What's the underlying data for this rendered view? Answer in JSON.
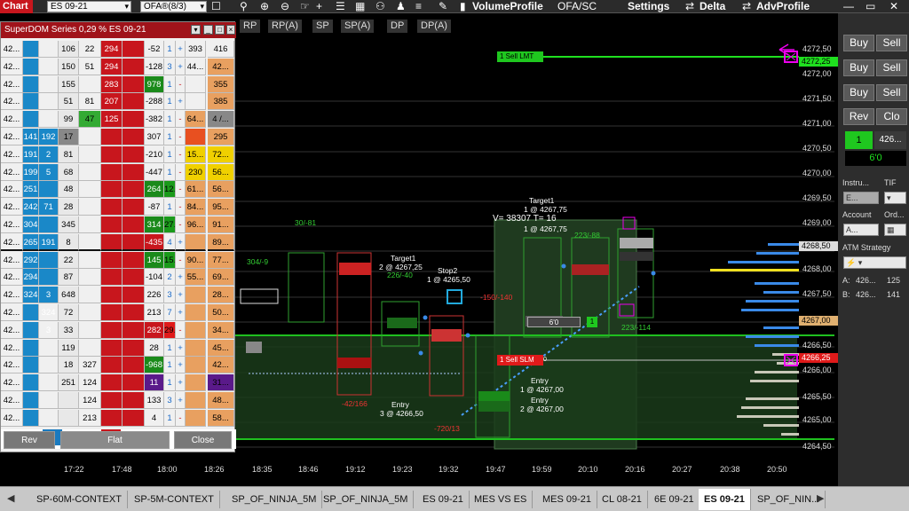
{
  "topbar": {
    "chart_label": "Chart",
    "instrument": "ES 09-21",
    "template": "OFA®(8/3)",
    "items": [
      "VolumeProfile",
      "OFA/SC",
      "Settings",
      "Delta",
      "AdvProfile"
    ]
  },
  "toolbar2": [
    "RP",
    "RP(A)",
    "SP",
    "SP(A)",
    "DP",
    "DP(A)"
  ],
  "price_axis": [
    "4272,50",
    "4272,25",
    "4272,00",
    "4271,50",
    "4271,00",
    "4270,50",
    "4270,00",
    "4269,50",
    "4269,00",
    "4268,50",
    "4268,00",
    "4267,50",
    "4267,00",
    "4266,50",
    "4266,25",
    "4266,00",
    "4265,50",
    "4265,00",
    "4264,50"
  ],
  "time_axis": [
    "17:22",
    "17:48",
    "18:00",
    "18:26",
    "18:35",
    "18:46",
    "19:12",
    "19:23",
    "19:32",
    "19:47",
    "19:59",
    "20:10",
    "20:16",
    "20:27",
    "20:38",
    "20:50"
  ],
  "dom": {
    "title": "SuperDOM Series 0,29 % ES 09-21",
    "header_price": "---",
    "rows": [
      [
        "42...",
        "",
        "",
        "106",
        "22",
        "294",
        "",
        "-52",
        "1",
        "+",
        "393",
        "416"
      ],
      [
        "42...",
        "",
        "",
        "150",
        "51",
        "294",
        "",
        "-128",
        "3",
        "+",
        "44...",
        "42..."
      ],
      [
        "42...",
        "",
        "",
        "155",
        "",
        "283",
        "",
        "978",
        "1",
        "-",
        "",
        "355"
      ],
      [
        "42...",
        "",
        "",
        "51",
        "81",
        "207",
        "",
        "-288",
        "1",
        "+",
        "",
        "385"
      ],
      [
        "42...",
        "",
        "",
        "99",
        "47",
        "125",
        "",
        "-382",
        "1",
        "-",
        "64...",
        "4 /..."
      ],
      [
        "42...",
        "141",
        "192",
        "17",
        "",
        "",
        "",
        "307",
        "1",
        "-",
        "",
        "295"
      ],
      [
        "42...",
        "191",
        "2",
        "81",
        "",
        "",
        "",
        "-210",
        "1",
        "-",
        "15...",
        "72..."
      ],
      [
        "42...",
        "199",
        "5",
        "68",
        "",
        "",
        "",
        "-447",
        "1",
        "-",
        "230",
        "56..."
      ],
      [
        "42...",
        "251",
        "",
        "48",
        "",
        "",
        "",
        "264",
        "12...",
        "-",
        "61...",
        "56..."
      ],
      [
        "42...",
        "242",
        "71",
        "28",
        "",
        "",
        "",
        "-87",
        "1",
        "-",
        "84...",
        "95..."
      ],
      [
        "42...",
        "304",
        "",
        "345",
        "",
        "",
        "",
        "314",
        "27...",
        "-",
        "96...",
        "91..."
      ],
      [
        "42...",
        "265",
        "191",
        "8",
        "",
        "",
        "",
        "-435",
        "4",
        "+",
        "",
        "89..."
      ],
      [
        "42...",
        "292",
        "",
        "22",
        "",
        "",
        "",
        "145",
        "15...",
        "-",
        "90...",
        "77..."
      ],
      [
        "42...",
        "294",
        "",
        "87",
        "",
        "",
        "",
        "-104",
        "2",
        "+",
        "55...",
        "69..."
      ],
      [
        "42...",
        "324",
        "3",
        "648",
        "",
        "",
        "",
        "226",
        "3",
        "+",
        "",
        "28..."
      ],
      [
        "42...",
        "",
        "324",
        "72",
        "",
        "",
        "",
        "213",
        "7",
        "+",
        "",
        "50..."
      ],
      [
        "42...",
        "",
        "3",
        "33",
        "",
        "",
        "",
        "282",
        "29...",
        "-",
        "",
        "34..."
      ],
      [
        "42...",
        "",
        "",
        "119",
        "",
        "",
        "",
        "28",
        "1",
        "+",
        "",
        "45..."
      ],
      [
        "42...",
        "",
        "",
        "18",
        "327",
        "",
        "",
        "-968",
        "1",
        "+",
        "",
        "42..."
      ],
      [
        "42...",
        "",
        "",
        "251",
        "124",
        "",
        "",
        "11",
        "1",
        "+",
        "",
        "31..."
      ],
      [
        "42...",
        "",
        "",
        "",
        "124",
        "",
        "",
        "133",
        "3",
        "+",
        "",
        "48..."
      ],
      [
        "42...",
        "",
        "",
        "",
        "213",
        "",
        "",
        "4",
        "1",
        "-",
        "",
        "58..."
      ]
    ],
    "footer": {
      "rev": "Rev",
      "flat": "Flat",
      "close": "Close"
    }
  },
  "orders": {
    "sell_lmt": "1  Sell LMT",
    "sell_slm": "1  Sell SLM",
    "position_qty": "1",
    "position_pnl": "6'0"
  },
  "annotations": {
    "volume": "V= 38307  T= 16",
    "target1a": "Target1",
    "target1a_detail": "2 @ 4267,25",
    "target1b": "Target1",
    "target1b_detail": "1 @ 4267,75",
    "target1b_detail2": "1 @ 4267,75",
    "stop2": "Stop2",
    "stop2_detail": "1 @ 4265,50",
    "entry_a": "Entry",
    "entry_a_detail": "3 @ 4266,50",
    "entry_b": "Entry",
    "entry_b_detail": "1 @ 4267,00",
    "entry_c": "Entry",
    "entry_c_detail": "2 @ 4267,00",
    "deltas": [
      "304/-9",
      "30/-81",
      "226/-40",
      "-150/-140",
      "223/-88",
      "223/-114",
      "-42/166",
      "-720/13"
    ]
  },
  "right_panel": {
    "buy": "Buy",
    "sell": "Sell",
    "rev": "Rev",
    "close": "Clo",
    "qty": "1",
    "price": "426...",
    "pnl": "6'0",
    "instrument_label": "Instru...",
    "tif_label": "TIF",
    "account_label": "Account",
    "order_label": "Ord...",
    "account_value": "A...",
    "atm_label": "ATM Strategy",
    "a_label": "A:",
    "a_price": "426...",
    "a_qty": "125",
    "b_label": "B:",
    "b_price": "426...",
    "b_qty": "141"
  },
  "tabs": [
    "SP-60M-CONTEXT",
    "SP-5M-CONTEXT",
    "SP_OF_NINJA_5M",
    "SP_OF_NINJA_5M",
    "ES 09-21",
    "MES VS ES",
    "MES 09-21",
    "CL 08-21",
    "6E 09-21",
    "ES 09-21",
    "SP_OF_NIN..."
  ],
  "active_tab": 9
}
